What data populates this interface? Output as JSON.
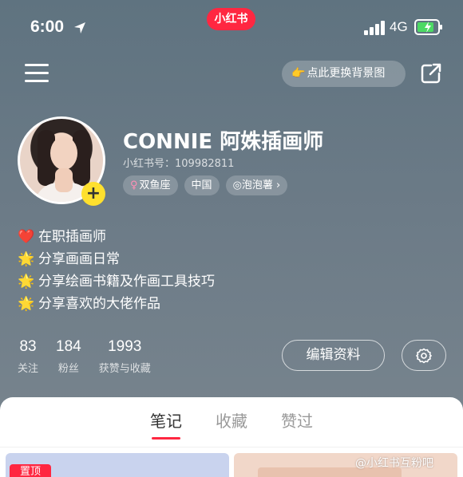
{
  "status_bar": {
    "time": "6:00",
    "network": "4G"
  },
  "app_badge": "小红书",
  "top_bar": {
    "background_button": "点此更换背景图",
    "background_button_emoji": "👉"
  },
  "profile": {
    "nickname": "CONNIE 阿姝插画师",
    "user_id": "小红书号：109982811",
    "tags": [
      {
        "icon": "♀",
        "label": "双鱼座"
      },
      {
        "label": "中国"
      },
      {
        "icon": "◎",
        "label": "泡泡薯 ›"
      }
    ],
    "add_button": "+"
  },
  "bio": [
    {
      "emoji": "❤️",
      "text": "在职插画师"
    },
    {
      "emoji": "🌟",
      "text": "分享画画日常"
    },
    {
      "emoji": "🌟",
      "text": "分享绘画书籍及作画工具技巧"
    },
    {
      "emoji": "🌟",
      "text": "分享喜欢的大佬作品"
    }
  ],
  "stats": [
    {
      "value": "83",
      "label": "关注"
    },
    {
      "value": "184",
      "label": "粉丝"
    },
    {
      "value": "1993",
      "label": "获赞与收藏"
    }
  ],
  "edit_button": "编辑资料",
  "tabs": [
    {
      "label": "笔记",
      "active": true
    },
    {
      "label": "收藏",
      "active": false
    },
    {
      "label": "赞过",
      "active": false
    }
  ],
  "pinned_label": "置顶",
  "watermark": "@小红书互粉吧",
  "colors": {
    "brand": "#ff2741",
    "add_button": "#ffe02e"
  }
}
